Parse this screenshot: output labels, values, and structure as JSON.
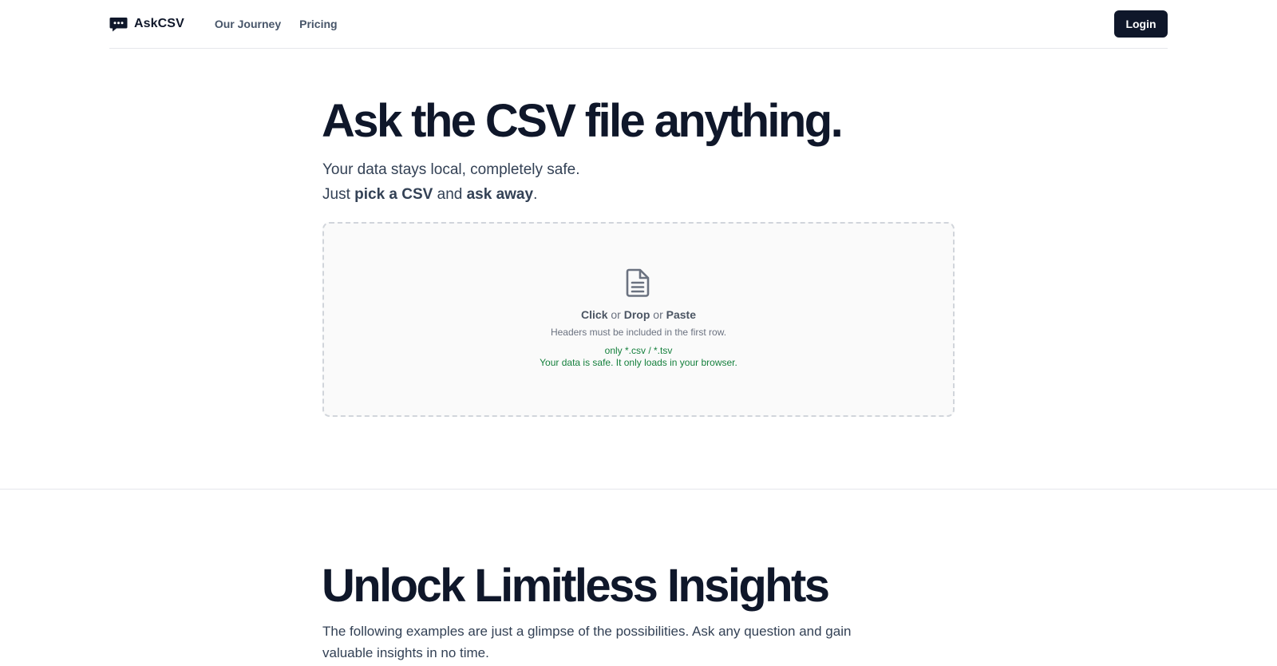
{
  "header": {
    "brand": "AskCSV",
    "nav": [
      {
        "label": "Our Journey"
      },
      {
        "label": "Pricing"
      }
    ],
    "login_label": "Login"
  },
  "hero": {
    "title": "Ask the CSV file anything.",
    "subtitle_line1": "Your data stays local, completely safe.",
    "subtitle_prefix": "Just ",
    "subtitle_bold1": "pick a CSV",
    "subtitle_mid": " and ",
    "subtitle_bold2": "ask away",
    "subtitle_end": "."
  },
  "dropzone": {
    "icon": "file-text-icon",
    "action_click": "Click",
    "or1": " or ",
    "action_drop": "Drop",
    "or2": " or ",
    "action_paste": "Paste",
    "hint": "Headers must be included in the first row.",
    "formats": "only *.csv / *.tsv",
    "safety": "Your data is safe. It only loads in your browser."
  },
  "section": {
    "title": "Unlock Limitless Insights",
    "description": "The following examples are just a glimpse of the possibilities. Ask any question and gain valuable insights in no time."
  },
  "colors": {
    "primary": "#0f172a",
    "muted": "#475569",
    "success": "#15803d",
    "border": "#e5e7eb"
  }
}
